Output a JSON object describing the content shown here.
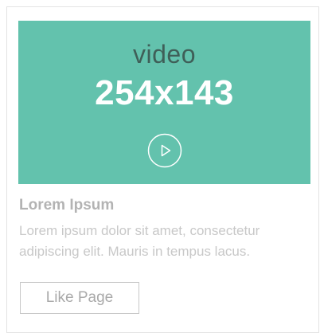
{
  "video": {
    "word": "video",
    "dimensions": "254x143",
    "play_icon": "play-circle-icon"
  },
  "card": {
    "title": "Lorem Ipsum",
    "description": "Lorem ipsum dolor sit amet, consectetur adipiscing elit. Mauris in tempus lacus.",
    "like_button_label": "Like Page"
  },
  "colors": {
    "video_background": "#63c2ad",
    "video_word": "#3f5f58",
    "video_dimensions": "#ffffff",
    "title_text": "#b3b3b3",
    "description_text": "#c8c8c8",
    "button_border": "#c8c8c8",
    "button_text": "#a9a9a9",
    "card_border": "#e3e3e3"
  }
}
